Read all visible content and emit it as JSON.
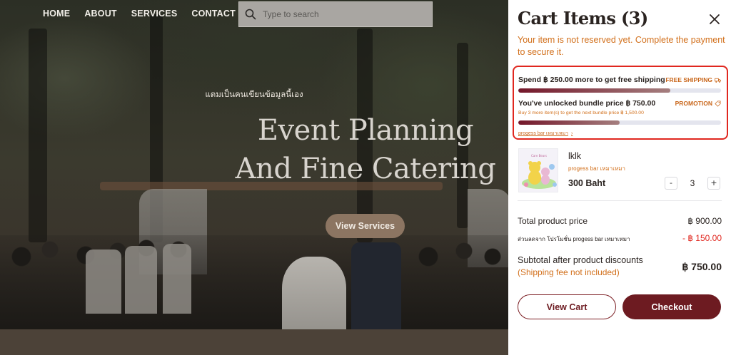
{
  "nav": {
    "items": [
      "HOME",
      "ABOUT",
      "SERVICES",
      "CONTACT"
    ]
  },
  "search": {
    "placeholder": "Type to search",
    "icon": "search-icon"
  },
  "hero": {
    "kicker": "แตมเป็นคนเขียนข้อมูลนี้เอง",
    "title_line1": "Event Planning",
    "title_line2": "And Fine Catering",
    "cta_label": "View Services"
  },
  "cart": {
    "title": "Cart Items (3)",
    "close_icon": "close-icon",
    "notice": "Your item is not reserved yet. Complete the payment to secure it.",
    "free_shipping": {
      "message": "Spend ฿ 250.00 more to get free shipping",
      "tag": "FREE SHIPPING",
      "tag_icon": "truck-icon",
      "progress": 0.75
    },
    "bundle": {
      "message": "You've unlocked bundle price ฿ 750.00",
      "tag": "PROMOTION",
      "tag_icon": "tag-icon",
      "sub": "Buy 3 more item(s) to get the next bundle price ฿ 1,500.00",
      "progress": 0.5
    },
    "progress_link": "progess bar เหมาเหมา",
    "progress_link_icon": "chevron-right-icon",
    "item": {
      "name": "lklk",
      "tag": "progess bar เหมาเหมา",
      "price": "300 Baht",
      "quantity": "3",
      "minus_label": "-",
      "plus_label": "+"
    },
    "summary": {
      "total_label": "Total product price",
      "total_value": "฿ 900.00",
      "discount_label": "ส่วนลดจาก โปรโมชั่น progess bar เหมาเหมา",
      "discount_value": "- ฿ 150.00",
      "subtotal_label": "Subtotal after product discounts",
      "subtotal_note": "(Shipping fee not included)",
      "subtotal_value": "฿ 750.00"
    },
    "view_cart_label": "View Cart",
    "checkout_label": "Checkout"
  },
  "colors": {
    "accent": "#6d1b21",
    "warning_text": "#d2701c",
    "discount_red": "#e0271f",
    "highlight_border": "#e0271f"
  }
}
